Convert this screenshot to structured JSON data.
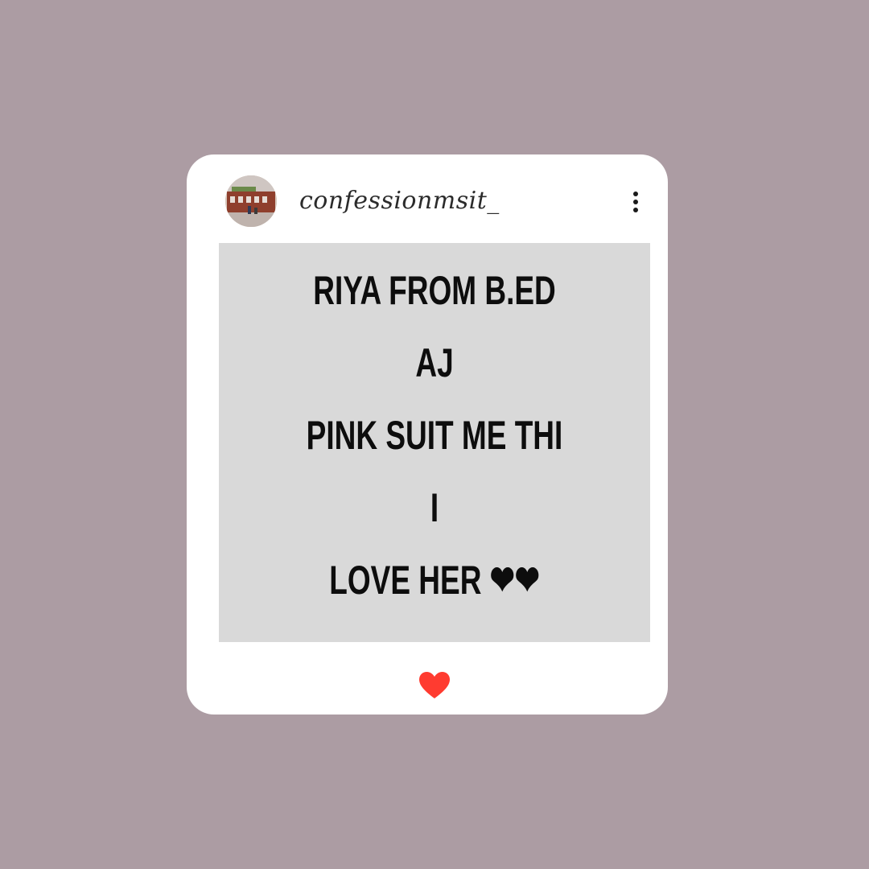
{
  "post": {
    "username": "confessionmsit_",
    "avatar": "profile-photo-building",
    "menu_icon": "more-vertical-icon",
    "text": "RIYA FROM B.ED AJ\nPINK SUIT ME THI I\nLOVE HER ❤❤",
    "like_icon": "heart-icon",
    "like_color": "#ff3b30"
  },
  "colors": {
    "background": "#ac9ca3",
    "card": "#ffffff",
    "post_area": "#d9d9d9",
    "text": "#0d0d0d"
  }
}
